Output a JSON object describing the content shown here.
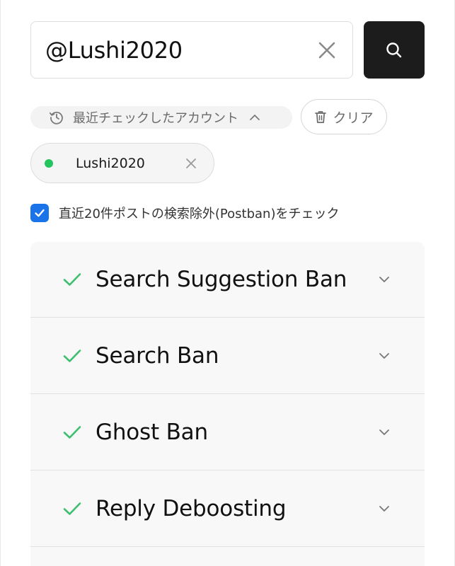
{
  "search": {
    "value": "@Lushi2020"
  },
  "recent": {
    "label": "最近チェックしたアカウント",
    "clear_label": "クリア",
    "accounts": [
      {
        "name": "Lushi2020",
        "status_color": "#22c55e"
      }
    ]
  },
  "options": {
    "postban_label": "直近20件ポストの検索除外(Postban)をチェック",
    "postban_checked": true
  },
  "results": [
    {
      "title": "Search Suggestion Ban",
      "status": "pass",
      "icon": "check-icon"
    },
    {
      "title": "Search Ban",
      "status": "pass",
      "icon": "check-icon"
    },
    {
      "title": "Ghost Ban",
      "status": "pass",
      "icon": "check-icon"
    },
    {
      "title": "Reply Deboosting",
      "status": "pass",
      "icon": "check-icon"
    }
  ],
  "colors": {
    "accent_blue": "#1a73e8",
    "pass_green": "#22c55e",
    "button_dark": "#1c1c1c"
  }
}
